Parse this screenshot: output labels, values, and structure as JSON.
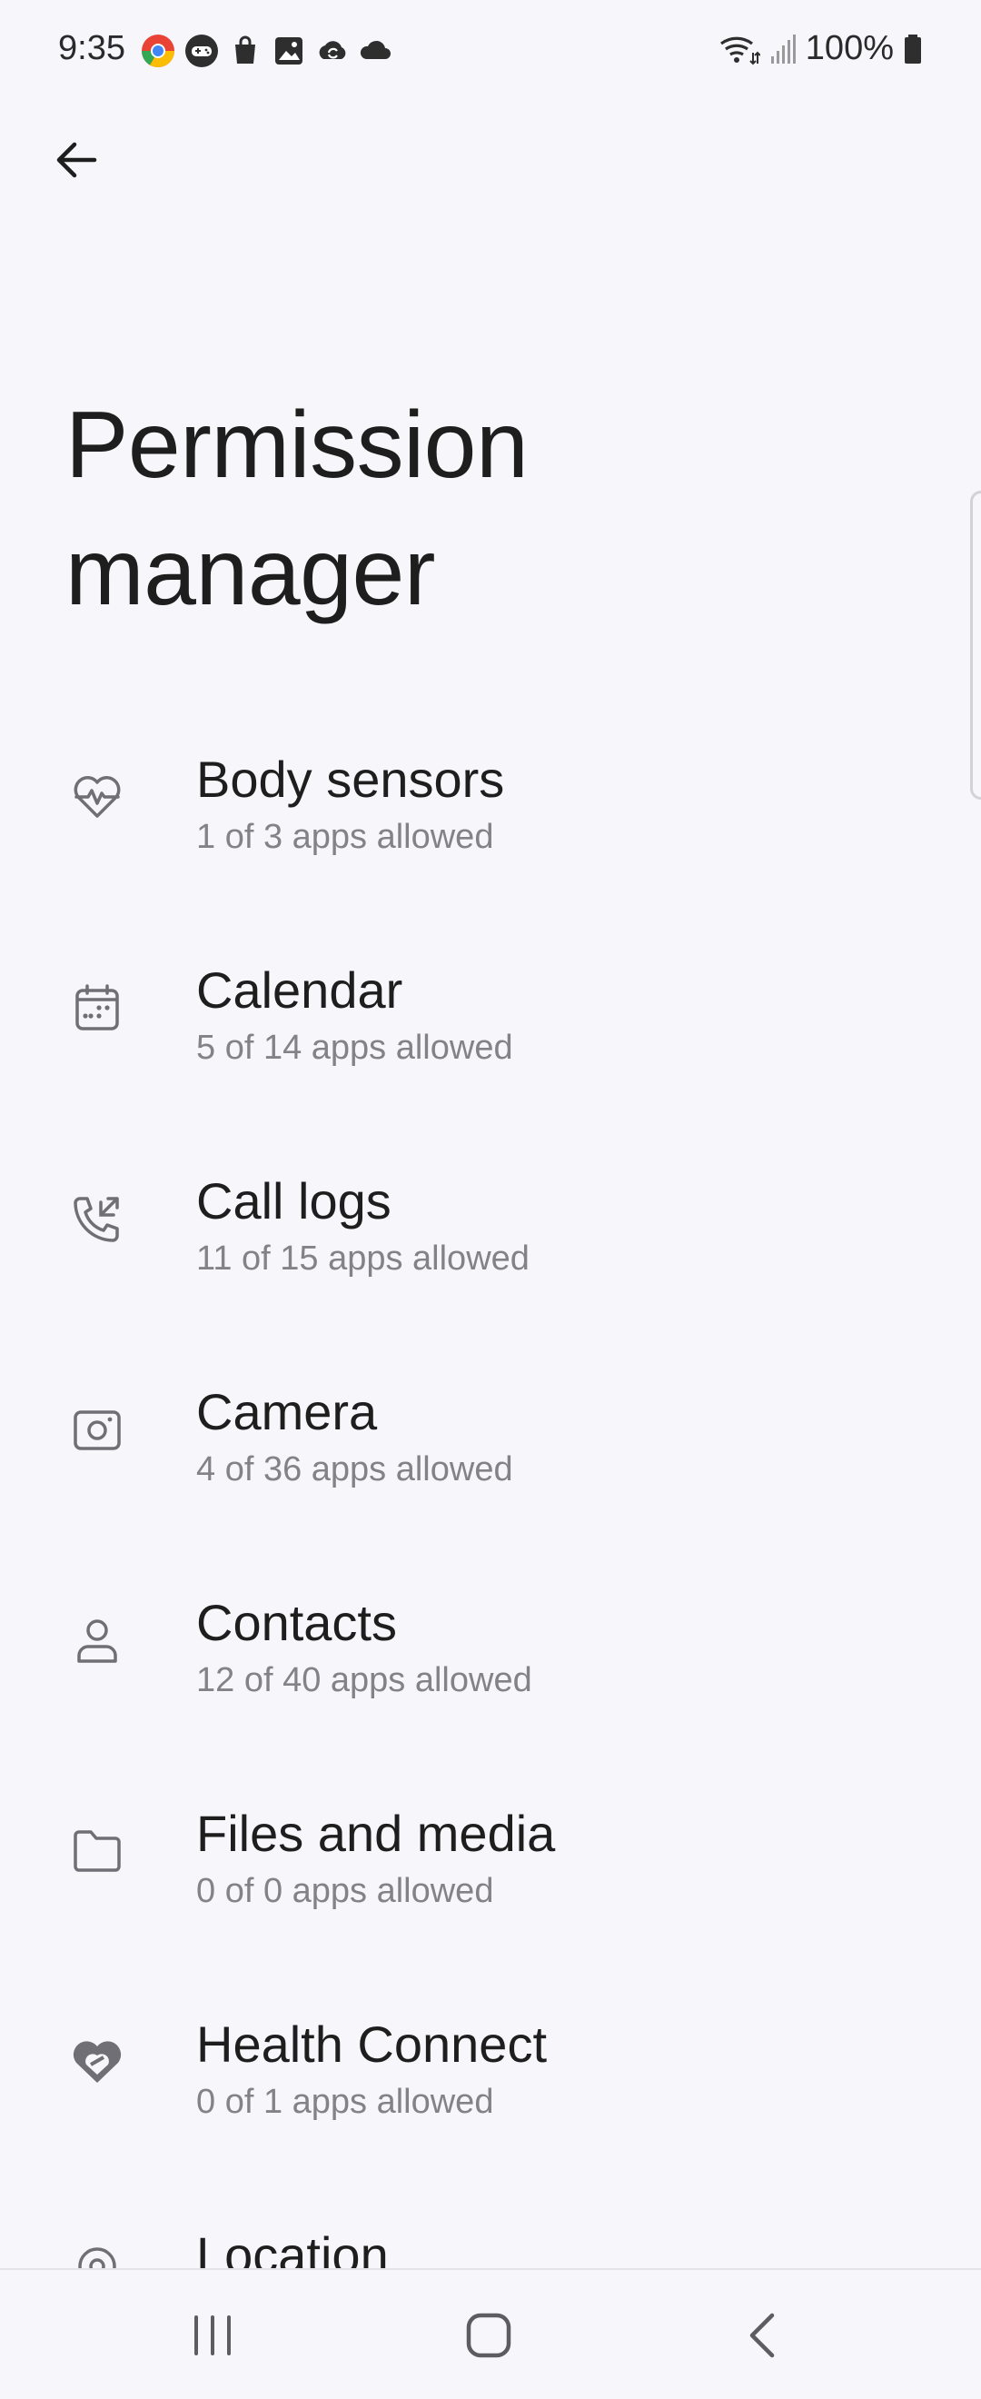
{
  "status_bar": {
    "time": "9:35",
    "notification_icons": [
      "chrome-icon",
      "game-controller-icon",
      "shopping-bag-icon",
      "gallery-icon",
      "sync-icon",
      "cloud-icon"
    ],
    "wifi_icon": "wifi-icon",
    "signal_icon": "signal-icon",
    "battery_percent": "100%",
    "battery_icon": "battery-icon"
  },
  "header": {
    "back_icon": "back-arrow-icon"
  },
  "page": {
    "title": "Permission manager"
  },
  "permissions": [
    {
      "label": "Body sensors",
      "summary": "1 of 3 apps allowed",
      "icon": "heart-pulse-icon"
    },
    {
      "label": "Calendar",
      "summary": "5 of 14 apps allowed",
      "icon": "calendar-icon"
    },
    {
      "label": "Call logs",
      "summary": "11 of 15 apps allowed",
      "icon": "call-log-icon"
    },
    {
      "label": "Camera",
      "summary": "4 of 36 apps allowed",
      "icon": "camera-icon"
    },
    {
      "label": "Contacts",
      "summary": "12 of 40 apps allowed",
      "icon": "contact-icon"
    },
    {
      "label": "Files and media",
      "summary": "0 of 0 apps allowed",
      "icon": "folder-icon"
    },
    {
      "label": "Health Connect",
      "summary": "0 of 1 apps allowed",
      "icon": "health-connect-icon"
    },
    {
      "label": "Location",
      "summary": "",
      "icon": "location-icon"
    }
  ],
  "nav_bar": {
    "recents_icon": "recents-icon",
    "home_icon": "home-icon",
    "back_icon": "nav-back-icon"
  },
  "colors": {
    "background": "#f7f7fb",
    "text_primary": "#1e1e1e",
    "text_secondary": "#828288",
    "icon_gray": "#6f6f75"
  }
}
